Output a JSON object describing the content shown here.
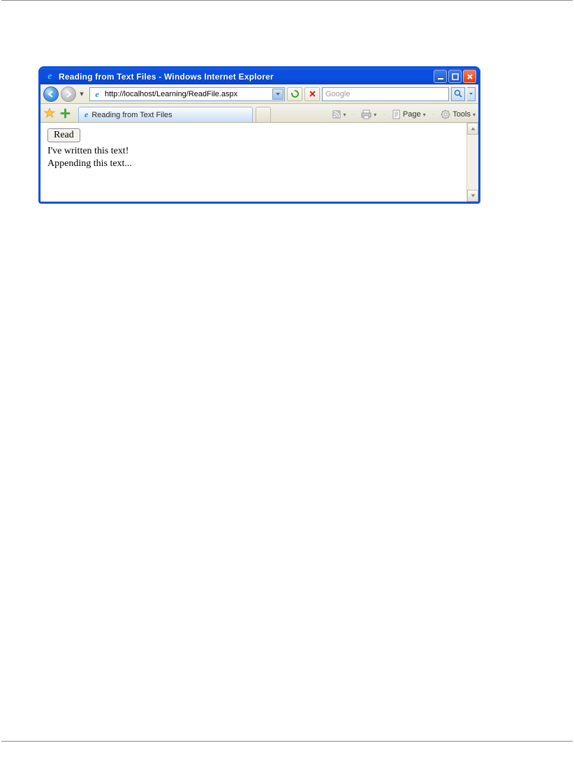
{
  "window": {
    "title": "Reading from Text Files - Windows Internet Explorer"
  },
  "address": {
    "url": "http://localhost/Learning/ReadFile.aspx"
  },
  "search": {
    "placeholder": "Google"
  },
  "tab": {
    "label": "Reading from Text Files"
  },
  "tools": {
    "page": "Page",
    "tools": "Tools"
  },
  "content": {
    "button": "Read",
    "line1": "I've written this text!",
    "line2": "Appending this text..."
  }
}
